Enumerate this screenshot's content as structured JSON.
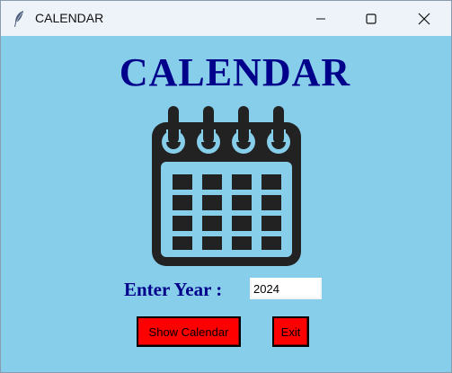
{
  "window": {
    "title": "CALENDAR",
    "controls": {
      "minimize": "minimize-icon",
      "maximize": "maximize-icon",
      "close": "close-icon"
    }
  },
  "main": {
    "heading": "CALENDAR",
    "icon": "calendar-icon",
    "year_label": "Enter Year :",
    "year_value": "2024",
    "show_button": "Show Calendar",
    "exit_button": "Exit"
  },
  "colors": {
    "background": "#87ceeb",
    "heading_text": "#00008b",
    "button_bg": "#ff0000",
    "icon": "#222222"
  }
}
